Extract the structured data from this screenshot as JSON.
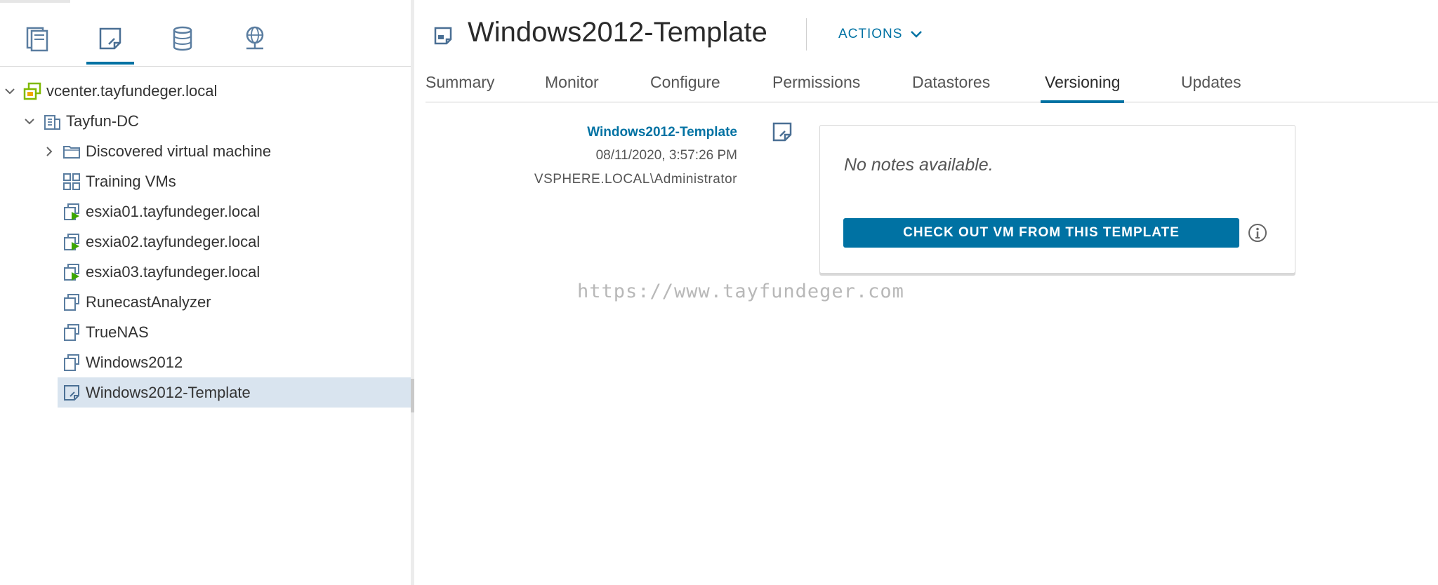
{
  "nav": {
    "tabs": [
      {
        "name": "hosts-and-clusters",
        "icon": "hosts-clusters-icon"
      },
      {
        "name": "vms-and-templates",
        "icon": "vm-template-icon",
        "active": true
      },
      {
        "name": "storage",
        "icon": "datastore-icon"
      },
      {
        "name": "networking",
        "icon": "network-icon"
      }
    ]
  },
  "tree": {
    "items": [
      {
        "label": "vcenter.tayfundeger.local",
        "icon": "vcenter-icon",
        "expanded": true,
        "level": 0
      },
      {
        "label": "Tayfun-DC",
        "icon": "datacenter-icon",
        "expanded": true,
        "level": 1
      },
      {
        "label": "Discovered virtual machine",
        "icon": "folder-icon",
        "expanded": false,
        "level": 2
      },
      {
        "label": "Training VMs",
        "icon": "vapp-icon",
        "level": 2
      },
      {
        "label": "esxia01.tayfundeger.local",
        "icon": "vm-powered-on-icon",
        "level": 2
      },
      {
        "label": "esxia02.tayfundeger.local",
        "icon": "vm-powered-on-icon",
        "level": 2
      },
      {
        "label": "esxia03.tayfundeger.local",
        "icon": "vm-powered-on-icon",
        "level": 2
      },
      {
        "label": "RunecastAnalyzer",
        "icon": "vm-icon",
        "level": 2
      },
      {
        "label": "TrueNAS",
        "icon": "vm-icon",
        "level": 2
      },
      {
        "label": "Windows2012",
        "icon": "vm-icon",
        "level": 2
      },
      {
        "label": "Windows2012-Template",
        "icon": "vm-template-icon",
        "level": 2,
        "selected": true
      }
    ]
  },
  "header": {
    "title": "Windows2012-Template",
    "actions_label": "ACTIONS"
  },
  "tabs": [
    {
      "label": "Summary"
    },
    {
      "label": "Monitor"
    },
    {
      "label": "Configure"
    },
    {
      "label": "Permissions"
    },
    {
      "label": "Datastores"
    },
    {
      "label": "Versioning",
      "active": true
    },
    {
      "label": "Updates"
    }
  ],
  "version": {
    "name": "Windows2012-Template",
    "date": "08/11/2020, 3:57:26 PM",
    "user": "VSPHERE.LOCAL\\Administrator"
  },
  "notes": {
    "text": "No notes available.",
    "checkout_label": "CHECK OUT VM FROM THIS TEMPLATE"
  },
  "watermark": "https://www.tayfundeger.com",
  "colors": {
    "accent": "#0072a3",
    "selected_row": "#d9e4ef",
    "powered_on": "#3ca600",
    "vcenter": "#7fb900"
  }
}
